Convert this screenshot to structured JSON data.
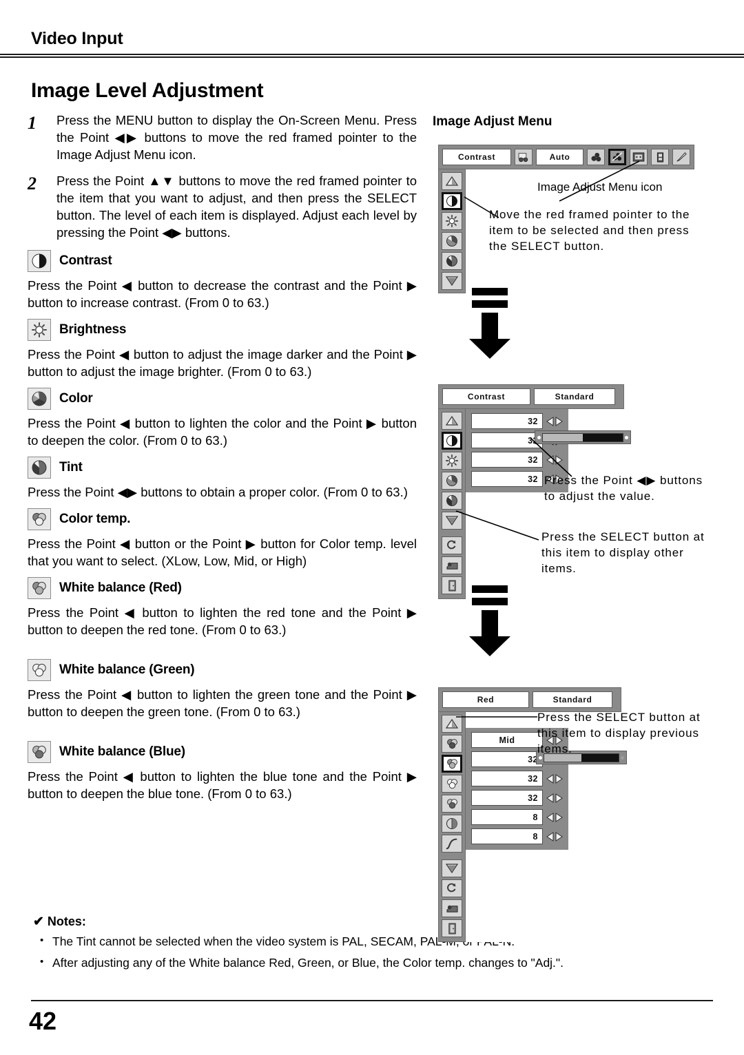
{
  "header": {
    "section_title": "Video Input"
  },
  "main_title": "Image Level Adjustment",
  "steps": [
    {
      "number": "1",
      "text": "Press the MENU button to display the On-Screen Menu.  Press the Point ◀▶ buttons to move the red framed pointer to the Image Adjust Menu icon."
    },
    {
      "number": "2",
      "text": "Press the Point ▲▼ buttons to move the red framed pointer to the item that you want to adjust, and then press the SELECT button.  The level of each item is displayed.  Adjust each level by pressing the Point ◀▶ buttons."
    }
  ],
  "sections": [
    {
      "icon": "contrast-icon",
      "label": "Contrast",
      "text": "Press the Point ◀ button to decrease the contrast and the Point ▶ button to increase contrast. (From 0 to 63.)"
    },
    {
      "icon": "brightness-icon",
      "label": "Brightness",
      "text": "Press the Point ◀ button to adjust the image darker and the Point ▶ button to adjust the image brighter. (From 0 to 63.)"
    },
    {
      "icon": "color-icon",
      "label": "Color",
      "text": "Press the Point ◀ button to lighten the color and the Point ▶ button to deepen the color. (From 0 to 63.)"
    },
    {
      "icon": "tint-icon",
      "label": "Tint",
      "text": "Press the Point ◀▶ buttons to obtain a proper color. (From 0 to 63.)"
    },
    {
      "icon": "color-temp-icon",
      "label": "Color temp.",
      "text": "Press the Point ◀ button or the Point ▶ button for Color temp. level that you want to select. (XLow, Low, Mid, or High)"
    },
    {
      "icon": "white-balance-red-icon",
      "label": "White balance (Red)",
      "text": "Press the Point ◀ button to lighten the red tone and the Point ▶ button to deepen the red tone. (From 0 to 63.)"
    },
    {
      "icon": "white-balance-green-icon",
      "label": "White balance (Green)",
      "text": "Press the Point ◀ button to lighten the green tone and the Point ▶ button to deepen the green tone. (From 0 to 63.)"
    },
    {
      "icon": "white-balance-blue-icon",
      "label": "White balance (Blue)",
      "text": "Press the Point ◀ button to lighten the blue tone and the Point ▶ button to deepen the blue tone. (From 0 to 63.)"
    }
  ],
  "notes": {
    "check_mark": "✔",
    "title": "Notes:",
    "bullet": "•",
    "items": [
      "The Tint cannot be selected when the video system is PAL, SECAM, PAL-M, or PAL-N.",
      "After adjusting any of the White balance Red, Green, or Blue, the Color temp. changes to \"Adj.\"."
    ]
  },
  "page_number": "42",
  "right_column": {
    "title": "Image Adjust Menu",
    "osd_top": {
      "field_left": "Contrast",
      "field_right": "Auto",
      "menu_icons": [
        "input-icon",
        "sound-icon",
        "image-adjust-icon",
        "screen-icon",
        "setting-icon",
        "pointer-icon"
      ],
      "selected_menu_icon": "image-adjust-icon",
      "side_icons": [
        "scroll-up-icon",
        "contrast-icon",
        "brightness-icon",
        "color-icon",
        "tint-icon",
        "scroll-down-icon"
      ],
      "selected_side_icon": "contrast-icon"
    },
    "callout_menu_icon": "Image Adjust Menu icon",
    "callout_move_pointer": "Move the red framed pointer to the item to be selected and then press the SELECT button.",
    "osd_mid": {
      "field_left": "Contrast",
      "field_right": "Standard",
      "side_icons": [
        "scroll-up-icon",
        "contrast-icon",
        "brightness-icon",
        "color-icon",
        "tint-icon",
        "scroll-down-icon",
        "reset-icon",
        "store-icon",
        "quit-icon"
      ],
      "selected_side_icon": "contrast-icon",
      "values": [
        "32",
        "32",
        "32",
        "32"
      ],
      "slider_percent": 50
    },
    "callout_adjust_value": "Press the Point ◀▶ buttons to adjust the value.",
    "callout_display_other": "Press the SELECT button at this item to display other items.",
    "osd_bottom": {
      "field_left": "Red",
      "field_right": "Standard",
      "side_icons": [
        "scroll-up-icon",
        "color-temp-icon",
        "white-balance-red-icon",
        "white-balance-green-icon",
        "white-balance-blue-icon",
        "sharpness-icon",
        "gamma-icon",
        "scroll-down-icon",
        "reset-icon",
        "store-icon",
        "quit-icon"
      ],
      "selected_side_icon": "white-balance-red-icon",
      "values": [
        "Mid",
        "32",
        "32",
        "32",
        "8",
        "8"
      ],
      "slider_percent": 50
    },
    "callout_display_previous": "Press the SELECT button at this item to display previous items."
  }
}
